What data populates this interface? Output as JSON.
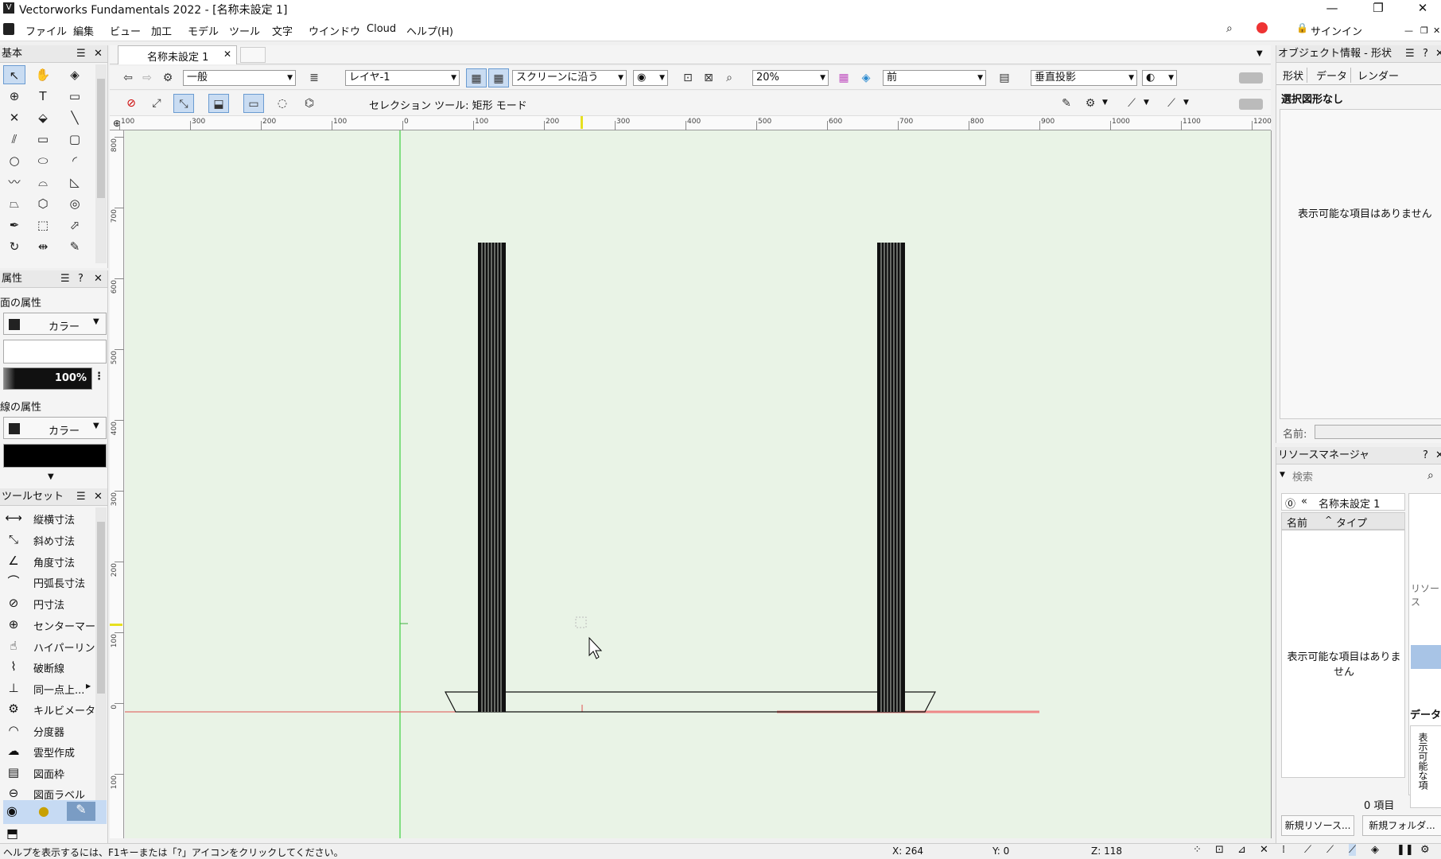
{
  "app": {
    "title": "Vectorworks Fundamentals 2022 - [名称未設定 1]"
  },
  "window_controls": {
    "minimize": "—",
    "maximize": "❐",
    "close": "✕"
  },
  "menu": [
    "ファイル",
    "編集",
    "ビュー",
    "加工",
    "モデル",
    "ツール",
    "文字",
    "ウインドウ",
    "Cloud",
    "ヘルプ(H)"
  ],
  "signin": "サインイン",
  "tabs": {
    "active": "名称未設定 1",
    "close": "✕"
  },
  "basic_palette": {
    "title": "基本"
  },
  "attributes": {
    "title": "属性",
    "fill_section": "面の属性",
    "fill_type": "カラー",
    "opacity": "100%",
    "line_section": "線の属性",
    "line_type": "カラー"
  },
  "toolset": {
    "title": "ツールセット",
    "items": [
      "縦横寸法",
      "斜め寸法",
      "角度寸法",
      "円弧長寸法",
      "円寸法",
      "センターマー...",
      "ハイパーリン...",
      "破断線",
      "同一点上...",
      "キルビメータ",
      "分度器",
      "雲型作成",
      "図面枠",
      "図面ラベル"
    ]
  },
  "view_bar": {
    "class": "一般",
    "layer": "レイヤ-1",
    "plane": "スクリーンに沿う",
    "zoom": "20%",
    "view": "前",
    "projection": "垂直投影"
  },
  "mode_bar": {
    "label": "セレクション ツール: 矩形 モード"
  },
  "ruler": {
    "h_labels": [
      "100",
      "300",
      "200",
      "100",
      "0",
      "100",
      "200",
      "300",
      "400",
      "500",
      "600",
      "700",
      "800",
      "900",
      "1000",
      "1100",
      "1200"
    ],
    "v_labels": [
      "800",
      "700",
      "600",
      "500",
      "400",
      "300",
      "200",
      "100",
      "0",
      "100"
    ]
  },
  "obj_info": {
    "title": "オブジェクト情報 - 形状",
    "tabs": [
      "形状",
      "データ",
      "レンダー"
    ],
    "selection": "選択図形なし",
    "empty": "表示可能な項目はありません",
    "name_label": "名前:"
  },
  "resource_manager": {
    "title": "リソースマネージャ",
    "search_placeholder": "検索",
    "file": "名称未設定 1",
    "col_name": "名前",
    "col_type": "タイプ",
    "empty": "表示可能な項目はありません",
    "count": "0 項目",
    "side_label": "リソース",
    "data_label": "データ",
    "data_empty": "表示可能な項",
    "new_resource": "新規リソース...",
    "new_folder": "新規フォルダ..."
  },
  "status": {
    "help": "ヘルプを表示するには、F1キーまたは「?」アイコンをクリックしてください。",
    "x": "X: 264",
    "y": "Y: 0",
    "z": "Z: 118"
  },
  "colors": {
    "canvas": "#e9f3e6",
    "accent": "#6a9bd1",
    "green_axis": "#60d860",
    "red_axis": "#e05050"
  }
}
